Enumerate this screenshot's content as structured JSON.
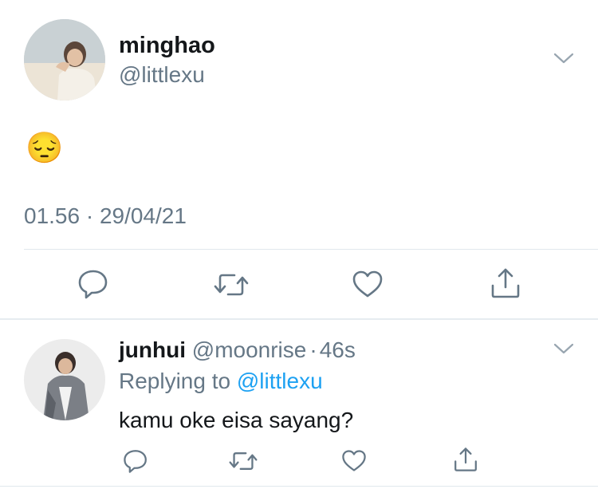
{
  "main_tweet": {
    "display_name": "minghao",
    "handle": "@littlexu",
    "text": "😔",
    "timestamp": "01.56 · 29/04/21"
  },
  "reply_tweet": {
    "display_name": "junhui",
    "handle": "@moonrise",
    "separator": "·",
    "time": "46s",
    "replying_prefix": "Replying to",
    "replying_handle": "@littlexu",
    "text": "kamu oke eisa sayang?"
  },
  "icons": {
    "more": "chevron-down-icon",
    "reply": "reply-icon",
    "retweet": "retweet-icon",
    "like": "heart-icon",
    "share": "share-icon"
  },
  "colors": {
    "text": "#14171a",
    "secondary": "#657786",
    "link": "#1da1f2",
    "divider": "#e1e8ed",
    "icon": "#657786"
  }
}
